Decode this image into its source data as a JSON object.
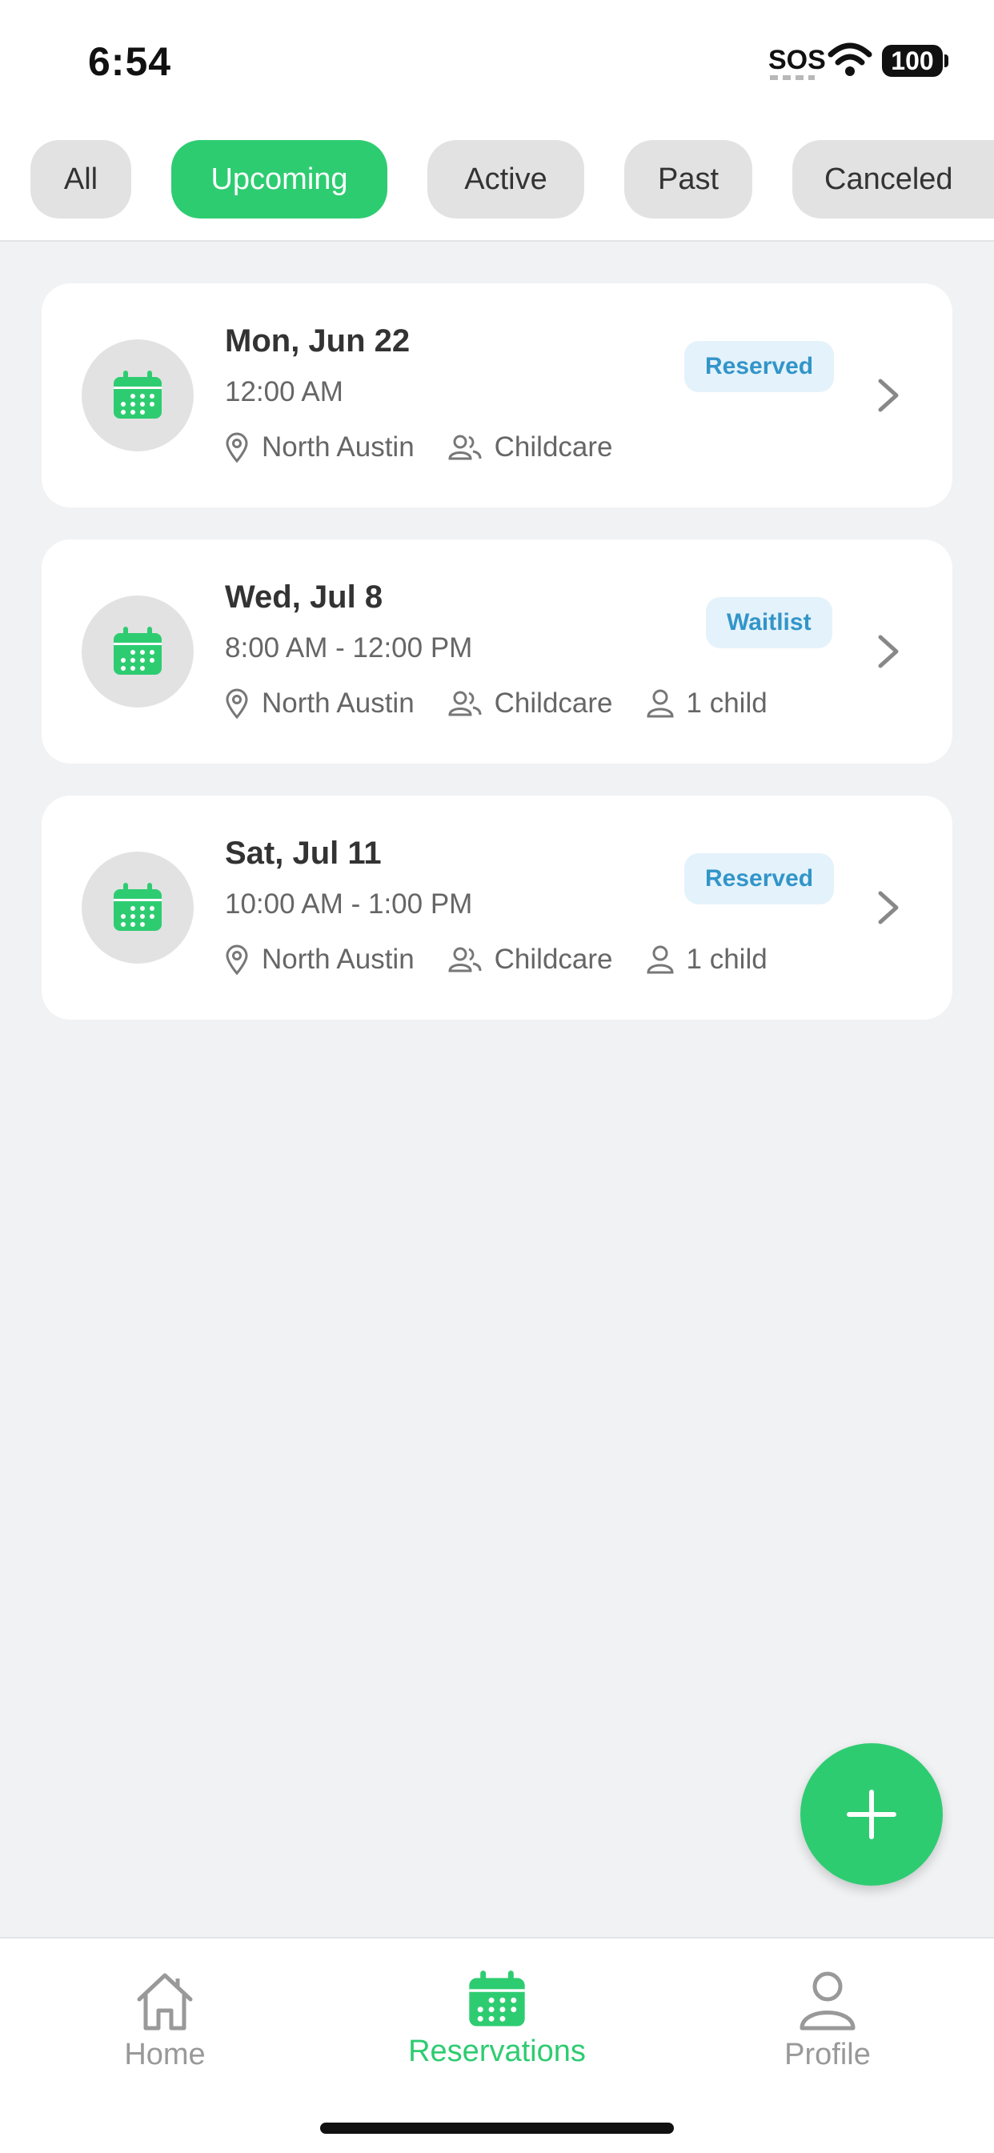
{
  "status_bar": {
    "time": "6:54",
    "sos": "SOS",
    "battery": "100"
  },
  "filters": [
    {
      "label": "All",
      "active": false
    },
    {
      "label": "Upcoming",
      "active": true
    },
    {
      "label": "Active",
      "active": false
    },
    {
      "label": "Past",
      "active": false
    },
    {
      "label": "Canceled",
      "active": false
    }
  ],
  "reservations": [
    {
      "date": "Mon, Jun 22",
      "time": "12:00 AM",
      "location": "North Austin",
      "program": "Childcare",
      "children": "",
      "status": "Reserved"
    },
    {
      "date": "Wed, Jul 8",
      "time": "8:00 AM - 12:00 PM",
      "location": "North Austin",
      "program": "Childcare",
      "children": "1 child",
      "status": "Waitlist"
    },
    {
      "date": "Sat, Jul 11",
      "time": "10:00 AM - 1:00 PM",
      "location": "North Austin",
      "program": "Childcare",
      "children": "1 child",
      "status": "Reserved"
    }
  ],
  "fab": {
    "icon": "plus-icon"
  },
  "bottom_nav": [
    {
      "label": "Home",
      "icon": "home-icon",
      "active": false
    },
    {
      "label": "Reservations",
      "icon": "calendar-icon",
      "active": true
    },
    {
      "label": "Profile",
      "icon": "person-icon",
      "active": false
    }
  ],
  "colors": {
    "accent": "#2ecc71",
    "badge_text": "#3295c9",
    "badge_bg": "#e4f2fb",
    "background": "#f0f2f4"
  }
}
